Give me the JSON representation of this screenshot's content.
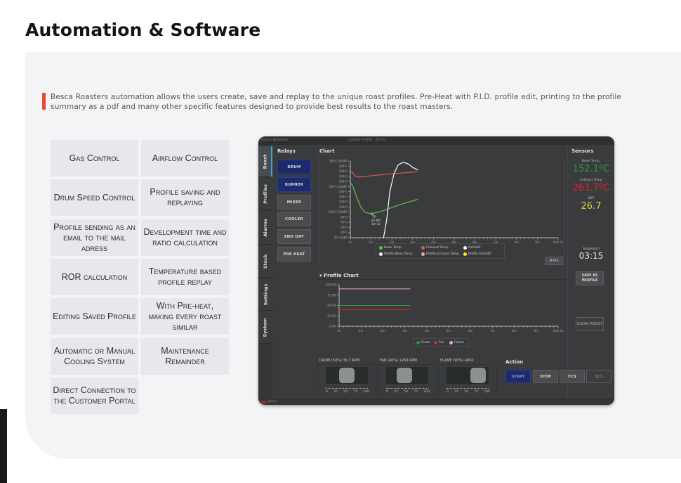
{
  "page": {
    "title": "Automation & Software",
    "intro": "Besca Roasters automation allows the users create, save and replay to the unique roast profiles. Pre-Heat with P.I.D. profile edit, printing to the profile summary as a pdf and many other specific features designed to provide best results to the roast masters.",
    "accent_color": "#e8483c"
  },
  "features": [
    {
      "label": "Gas Control"
    },
    {
      "label": "Airflow Control"
    },
    {
      "label": "Drum Speed Control"
    },
    {
      "label": "Profile saving and replaying"
    },
    {
      "label": "Profile sending as an email to the mail adress"
    },
    {
      "label": "Development time and ratio calculation"
    },
    {
      "label": "ROR calculation"
    },
    {
      "label": "Temperature based profile replay"
    },
    {
      "label": "Editing Saved Profile"
    },
    {
      "label": "With Pre-heat, making every roast similar"
    },
    {
      "label": "Automatic or Manual Cooling System"
    },
    {
      "label": "Maintenance Remainder"
    },
    {
      "label": "Direct Connection to the Customer Portal"
    }
  ],
  "app": {
    "title": "Besca Roasters",
    "loaded_profile": "Loaded Profile : None",
    "tabs": [
      {
        "label": "Roast",
        "active": true
      },
      {
        "label": "Profiles"
      },
      {
        "label": "Alarms"
      },
      {
        "label": "Stock"
      },
      {
        "label": "Settings"
      },
      {
        "label": "System"
      }
    ],
    "relays": {
      "title": "Relays",
      "buttons": [
        {
          "label": "DRUM",
          "on": true
        },
        {
          "label": "BURNER",
          "on": true
        },
        {
          "label": "MIXER",
          "on": false
        },
        {
          "label": "COOLER",
          "on": false
        },
        {
          "label": "END DAY",
          "on": false
        },
        {
          "label": "PRE HEAT",
          "on": false
        }
      ]
    },
    "chart_title": "Chart",
    "mark_button": "MARK",
    "sensors": {
      "title": "Sensors",
      "bean_temp_label": "Bean Temp.",
      "bean_temp": "152.1ºC",
      "exhaust_temp_label": "Exhaust Temp",
      "exhaust_temp": "261.7ºC",
      "delta_label": "ΔBT",
      "delta_value": "26.7",
      "stopwatch_label": "Stopwatch",
      "stopwatch": "03:15",
      "save_profile": "SAVE AS PROFILE",
      "clear_roast": "CLEAR ROAST"
    },
    "profile_chart_title": "▾ Profile Chart",
    "sliders": [
      {
        "label": "DRUM (50%) 39.7 RPM",
        "value": 50
      },
      {
        "label": "FAN (40%) 1269 RPM",
        "value": 40
      },
      {
        "label": "FLAME (90%) 4950",
        "value": 90
      }
    ],
    "slider_scale": [
      "0",
      "25",
      "50",
      "75",
      "100"
    ],
    "action": {
      "title": "Action",
      "buttons": [
        {
          "label": "START",
          "style": "start"
        },
        {
          "label": "STOP",
          "style": "normal"
        },
        {
          "label": "FCS",
          "style": "normal"
        },
        {
          "label": "SCS",
          "style": "disabled"
        }
      ]
    },
    "status": "None",
    "colors": {
      "bean": "#5fc04f",
      "exhaust": "#e05a55",
      "delta": "#ffffff",
      "profile_bean": "#f2f2f2",
      "profile_exhaust": "#f0a8a8",
      "profile_delta": "#ffee00",
      "bean_value": "#2e9c46",
      "exhaust_value": "#e0262b",
      "delta_value": "#d6d63a",
      "drum": "#1f9a3a",
      "fan": "#e0262b",
      "flame": "#e8a6d6"
    }
  },
  "chart_data": [
    {
      "type": "line",
      "title": "Chart",
      "x_ticks": [
        "0s",
        "1m",
        "2m",
        "3m",
        "4m",
        "5m",
        "6m",
        "7m",
        "8m",
        "9m",
        "10m 1s"
      ],
      "y_ticks": [
        "0ºC;0ΔBT",
        "20ºC",
        "40ºC",
        "60ºC",
        "80ºC",
        "100ºC;10ΔBT",
        "120ºC",
        "140ºC",
        "160ºC",
        "180ºC",
        "200ºC;20ΔBT",
        "220ºC",
        "240ºC",
        "260ºC",
        "280ºC",
        "300ºC;30ΔBT"
      ],
      "xlim_min": [
        0,
        10
      ],
      "ylim": [
        0,
        300
      ],
      "series": [
        {
          "name": "Bean Temp",
          "x": [
            0,
            0.1,
            0.3,
            0.5,
            0.7,
            1.0,
            1.5,
            2.0,
            2.5,
            3.25
          ],
          "y": [
            215,
            205,
            160,
            120,
            100,
            93,
            103,
            118,
            132,
            150
          ]
        },
        {
          "name": "Exhaust Temp",
          "x": [
            0,
            0.1,
            0.25,
            0.4,
            1.0,
            2.0,
            3.25
          ],
          "y": [
            260,
            255,
            240,
            237,
            242,
            250,
            258
          ]
        },
        {
          "name": "DeltaBT",
          "x": [
            1.6,
            1.75,
            1.9,
            2.1,
            2.3,
            2.55,
            2.8,
            3.0,
            3.25
          ],
          "y": [
            0,
            70,
            180,
            250,
            285,
            295,
            288,
            275,
            265
          ]
        }
      ],
      "legend": [
        "Bean Temp",
        "Exhaust Temp",
        "DeltaBT",
        "Profile Bean Temp",
        "Profile Exhaust Temp",
        "Profile DeltaBT"
      ],
      "annotation": {
        "label": "TP",
        "value": "92.8ºC",
        "time": "1m 3s",
        "x": 1.05,
        "y": 93
      }
    },
    {
      "type": "line",
      "title": "Profile Chart",
      "x_ticks": [
        "0s",
        "1m",
        "2m",
        "3m",
        "4m",
        "5m",
        "6m",
        "7m",
        "8m",
        "9m",
        "10m 1s"
      ],
      "y_ticks": [
        "0.0%",
        "25.0%",
        "50.0%",
        "75.0%",
        "100.0%"
      ],
      "ylim": [
        0,
        100
      ],
      "series": [
        {
          "name": "Drum",
          "x": [
            0,
            3.25
          ],
          "y": [
            50,
            50
          ]
        },
        {
          "name": "Fan",
          "x": [
            0,
            3.25
          ],
          "y": [
            40,
            40
          ]
        },
        {
          "name": "Flame",
          "x": [
            0,
            3.25
          ],
          "y": [
            90,
            90
          ]
        }
      ],
      "legend": [
        "Drum",
        "Fan",
        "Flame"
      ]
    }
  ]
}
